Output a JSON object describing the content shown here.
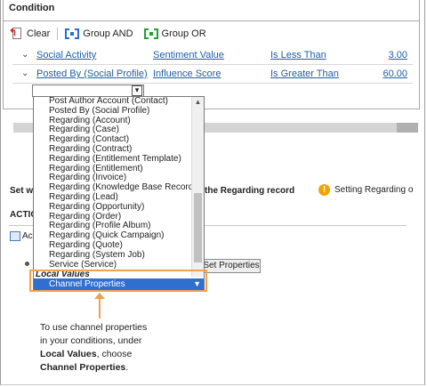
{
  "panel": {
    "title": "Condition"
  },
  "toolbar": {
    "clear": "Clear",
    "group_and": "Group AND",
    "group_or": "Group OR"
  },
  "rows": [
    {
      "field": "Social Activity",
      "attribute": "Sentiment Value",
      "operator": "Is Less Than",
      "value": "3.00"
    },
    {
      "field": "Posted By (Social Profile)",
      "attribute": "Influence Score",
      "operator": "Is Greater Than",
      "value": "60.00"
    }
  ],
  "dropdown": {
    "items": [
      "Post Author Account (Contact)",
      "Posted By (Social Profile)",
      "Regarding (Account)",
      "Regarding (Case)",
      "Regarding (Contact)",
      "Regarding (Contract)",
      "Regarding (Entitlement Template)",
      "Regarding (Entitlement)",
      "Regarding (Invoice)",
      "Regarding (Knowledge Base Record)",
      "Regarding (Lead)",
      "Regarding (Opportunity)",
      "Regarding (Order)",
      "Regarding (Profile Album)",
      "Regarding (Quick Campaign)",
      "Regarding (Quote)",
      "Regarding (System Job)",
      "Service (Service)"
    ],
    "group_label": "Local Values",
    "selected": "Channel Properties"
  },
  "background": {
    "set_w": "Set w",
    "regarding_record": "the Regarding record",
    "warning": "Setting Regarding o",
    "actio": "ACTIO",
    "ac": "Ac",
    "set_properties": "Set Properties"
  },
  "callout": {
    "line1": "To use channel properties",
    "line2": "in your conditions, under",
    "bold1": "Local Values",
    "line3": ", choose",
    "bold2": "Channel Properties",
    "line4": "."
  },
  "colors": {
    "link": "#1f5fa8",
    "highlight": "#2f6fd0",
    "callout": "#f0a050",
    "warning": "#f2a500"
  }
}
